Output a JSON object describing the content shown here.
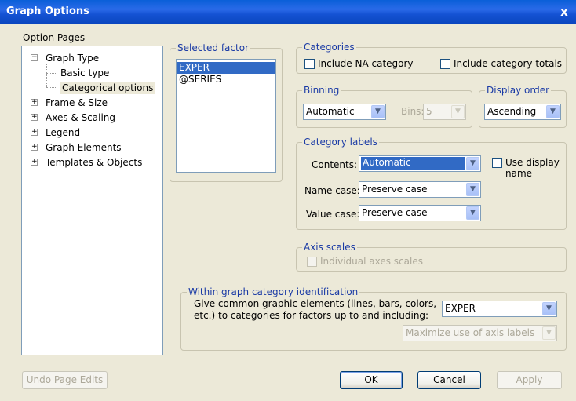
{
  "window": {
    "title": "Graph Options",
    "close_glyph": "x"
  },
  "option_pages": {
    "label": "Option Pages",
    "tree": {
      "graph_type": "Graph Type",
      "basic_type": "Basic type",
      "categorical_options": "Categorical options",
      "frame_size": "Frame & Size",
      "axes_scaling": "Axes & Scaling",
      "legend": "Legend",
      "graph_elements": "Graph Elements",
      "templates_objects": "Templates & Objects"
    },
    "expander_minus": "−",
    "expander_plus": "+"
  },
  "selected_factor": {
    "label": "Selected factor",
    "items": [
      "EXPER",
      "@SERIES"
    ],
    "selected": "EXPER"
  },
  "categories": {
    "label": "Categories",
    "include_na": "Include NA category",
    "include_totals": "Include category totals"
  },
  "binning": {
    "label": "Binning",
    "mode_value": "Automatic",
    "bins_label": "Bins:",
    "bins_value": "5"
  },
  "display_order": {
    "label": "Display order",
    "value": "Ascending"
  },
  "category_labels": {
    "label": "Category labels",
    "contents_label": "Contents:",
    "contents_value": "Automatic",
    "name_case_label": "Name case:",
    "name_case_value": "Preserve case",
    "value_case_label": "Value case:",
    "value_case_value": "Preserve case",
    "use_display_name": "Use display\nname"
  },
  "axis_scales": {
    "label": "Axis scales",
    "individual": "Individual axes scales"
  },
  "within_graph": {
    "label": "Within graph category identification",
    "description_line1": "Give common graphic elements (lines, bars, colors,",
    "description_line2": "etc.) to categories for factors up to and including:",
    "factor_value": "EXPER",
    "axis_labels_value": "Maximize use of axis labels"
  },
  "buttons": {
    "undo": "Undo Page Edits",
    "ok": "OK",
    "cancel": "Cancel",
    "apply": "Apply"
  },
  "icons": {
    "dropdown": "chevron-down-icon",
    "close": "close-icon"
  }
}
